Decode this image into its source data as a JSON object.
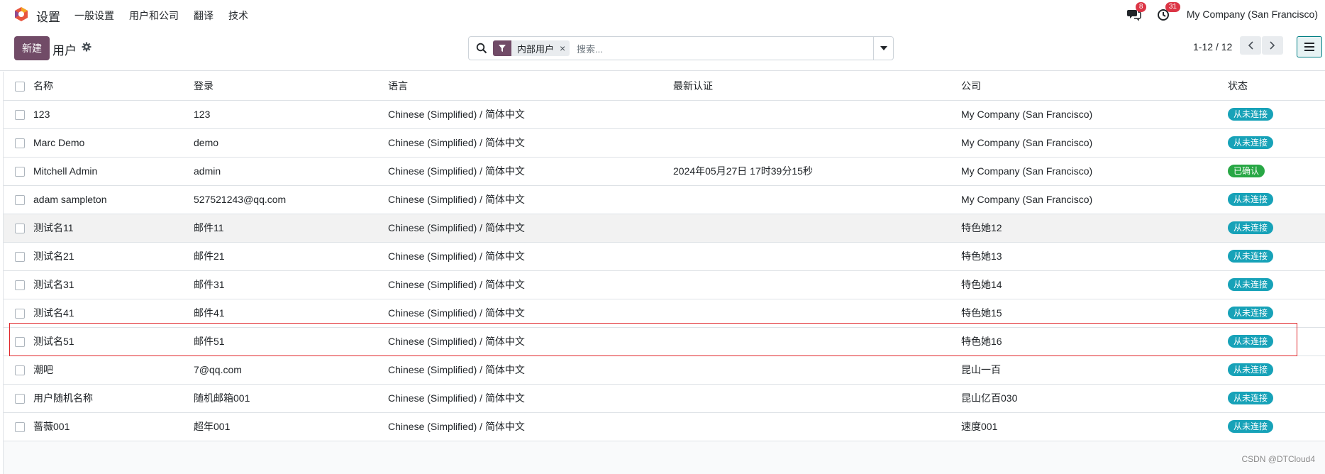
{
  "navbar": {
    "app_title": "设置",
    "menu": [
      "一般设置",
      "用户和公司",
      "翻译",
      "技术"
    ],
    "messages_count": "8",
    "activities_count": "31",
    "company": "My Company (San Francisco)"
  },
  "control_panel": {
    "new_button": "新建",
    "title": "用户",
    "search": {
      "facet": "内部用户",
      "placeholder": "搜索..."
    },
    "pager": "1-12 / 12"
  },
  "table": {
    "headers": [
      "名称",
      "登录",
      "语言",
      "最新认证",
      "公司",
      "状态"
    ],
    "rows": [
      {
        "name": "123",
        "login": "123",
        "language": "Chinese (Simplified) / 简体中文",
        "latest_auth": "",
        "company": "My Company (San Francisco)",
        "status": "从未连接",
        "status_kind": "never"
      },
      {
        "name": "Marc Demo",
        "login": "demo",
        "language": "Chinese (Simplified) / 简体中文",
        "latest_auth": "",
        "company": "My Company (San Francisco)",
        "status": "从未连接",
        "status_kind": "never"
      },
      {
        "name": "Mitchell Admin",
        "login": "admin",
        "language": "Chinese (Simplified) / 简体中文",
        "latest_auth": "2024年05月27日 17时39分15秒",
        "company": "My Company (San Francisco)",
        "status": "已确认",
        "status_kind": "confirmed"
      },
      {
        "name": "adam sampleton",
        "login": "527521243@qq.com",
        "language": "Chinese (Simplified) / 简体中文",
        "latest_auth": "",
        "company": "My Company (San Francisco)",
        "status": "从未连接",
        "status_kind": "never"
      },
      {
        "name": "测试名11",
        "login": "邮件11",
        "language": "Chinese (Simplified) / 简体中文",
        "latest_auth": "",
        "company": "特色她12",
        "status": "从未连接",
        "status_kind": "never"
      },
      {
        "name": "测试名21",
        "login": "邮件21",
        "language": "Chinese (Simplified) / 简体中文",
        "latest_auth": "",
        "company": "特色她13",
        "status": "从未连接",
        "status_kind": "never"
      },
      {
        "name": "测试名31",
        "login": "邮件31",
        "language": "Chinese (Simplified) / 简体中文",
        "latest_auth": "",
        "company": "特色她14",
        "status": "从未连接",
        "status_kind": "never"
      },
      {
        "name": "测试名41",
        "login": "邮件41",
        "language": "Chinese (Simplified) / 简体中文",
        "latest_auth": "",
        "company": "特色她15",
        "status": "从未连接",
        "status_kind": "never"
      },
      {
        "name": "测试名51",
        "login": "邮件51",
        "language": "Chinese (Simplified) / 简体中文",
        "latest_auth": "",
        "company": "特色她16",
        "status": "从未连接",
        "status_kind": "never"
      },
      {
        "name": "潮吧",
        "login": "7@qq.com",
        "language": "Chinese (Simplified) / 简体中文",
        "latest_auth": "",
        "company": "昆山一百",
        "status": "从未连接",
        "status_kind": "never"
      },
      {
        "name": "用户随机名称",
        "login": "随机邮箱001",
        "language": "Chinese (Simplified) / 简体中文",
        "latest_auth": "",
        "company": "昆山亿百030",
        "status": "从未连接",
        "status_kind": "never"
      },
      {
        "name": "蔷薇001",
        "login": "超年001",
        "language": "Chinese (Simplified) / 简体中文",
        "latest_auth": "",
        "company": "速度001",
        "status": "从未连接",
        "status_kind": "never"
      }
    ]
  },
  "colors": {
    "brand": "#714b67",
    "status_never": "#17a2b8",
    "status_confirmed": "#28a745",
    "highlight": "#e0262a"
  },
  "icons": [
    "odoo-logo-icon",
    "gear-icon",
    "search-icon",
    "filter-icon",
    "chevron-down-icon",
    "chevron-left-icon",
    "chevron-right-icon",
    "list-view-icon",
    "chat-icon",
    "clock-icon"
  ],
  "watermark": "CSDN @DTCloud4"
}
